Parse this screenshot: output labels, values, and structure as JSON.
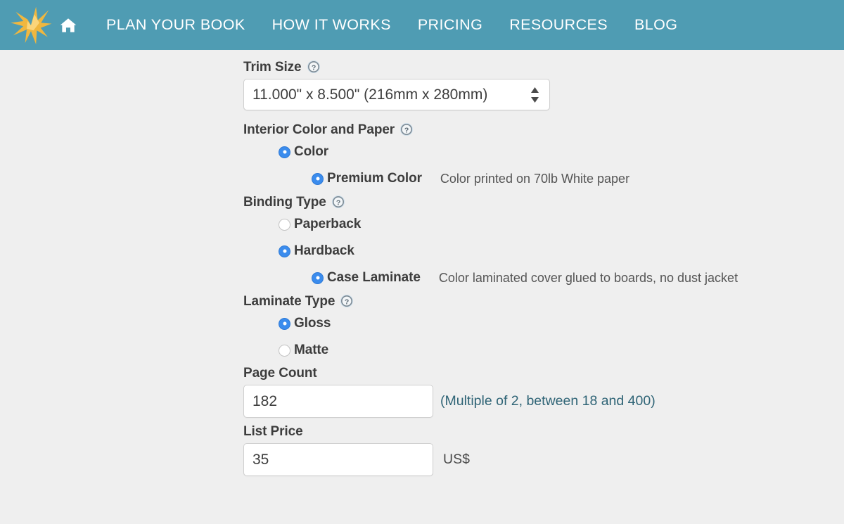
{
  "navbar": {
    "background_color": "#4f9cb3",
    "logo_color": "#f0b73f",
    "logo_name": "starburst-logo",
    "home_label": "Home",
    "links": [
      {
        "label": "PLAN YOUR BOOK"
      },
      {
        "label": "HOW IT WORKS"
      },
      {
        "label": "PRICING"
      },
      {
        "label": "RESOURCES"
      },
      {
        "label": "BLOG"
      }
    ]
  },
  "form": {
    "trim_size": {
      "label": "Trim Size",
      "help": "?",
      "selected": "11.000\" x 8.500\" (216mm x 280mm)"
    },
    "interior": {
      "label": "Interior Color and Paper",
      "help": "?",
      "options": [
        {
          "label": "Color",
          "selected": true,
          "level": 1,
          "desc": ""
        },
        {
          "label": "Premium Color",
          "selected": true,
          "level": 2,
          "desc": "Color printed on 70lb White paper"
        }
      ]
    },
    "binding": {
      "label": "Binding Type",
      "help": "?",
      "options": [
        {
          "label": "Paperback",
          "selected": false,
          "level": 1,
          "desc": ""
        },
        {
          "label": "Hardback",
          "selected": true,
          "level": 1,
          "desc": ""
        },
        {
          "label": "Case Laminate",
          "selected": true,
          "level": 2,
          "desc": "Color laminated cover glued to boards, no dust jacket"
        }
      ]
    },
    "laminate": {
      "label": "Laminate Type",
      "help": "?",
      "options": [
        {
          "label": "Gloss",
          "selected": true,
          "level": 1,
          "desc": ""
        },
        {
          "label": "Matte",
          "selected": false,
          "level": 1,
          "desc": ""
        }
      ]
    },
    "page_count": {
      "label": "Page Count",
      "value": "182",
      "hint": "(Multiple of 2, between 18 and 400)"
    },
    "list_price": {
      "label": "List Price",
      "value": "35",
      "unit": "US$"
    }
  },
  "colors": {
    "nav_teal": "#4f9cb3",
    "radio_blue": "#3b8ced",
    "hint_slate": "#2f6476",
    "page_bg": "#efefef",
    "label_gray": "#3d3d3d"
  }
}
